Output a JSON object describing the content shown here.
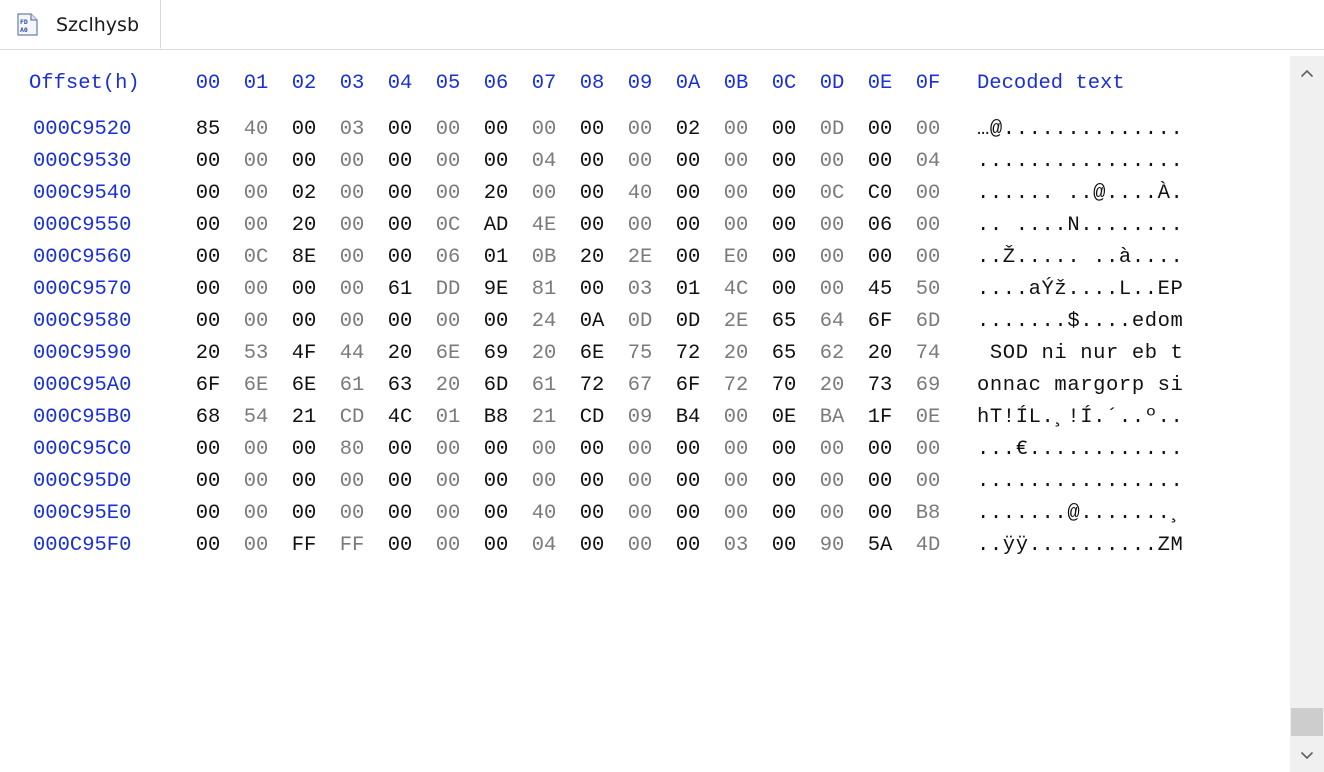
{
  "tab": {
    "label": "Szclhysb",
    "icon": "hex-file-icon"
  },
  "header": {
    "offset_label": "Offset(h)",
    "columns": [
      "00",
      "01",
      "02",
      "03",
      "04",
      "05",
      "06",
      "07",
      "08",
      "09",
      "0A",
      "0B",
      "0C",
      "0D",
      "0E",
      "0F"
    ],
    "text_label": "Decoded text"
  },
  "rows": [
    {
      "offset": "000C9520",
      "bytes": [
        "85",
        "40",
        "00",
        "03",
        "00",
        "00",
        "00",
        "00",
        "00",
        "00",
        "02",
        "00",
        "00",
        "0D",
        "00",
        "00"
      ],
      "text": "…@.............."
    },
    {
      "offset": "000C9530",
      "bytes": [
        "00",
        "00",
        "00",
        "00",
        "00",
        "00",
        "00",
        "04",
        "00",
        "00",
        "00",
        "00",
        "00",
        "00",
        "00",
        "04"
      ],
      "text": "................"
    },
    {
      "offset": "000C9540",
      "bytes": [
        "00",
        "00",
        "02",
        "00",
        "00",
        "00",
        "20",
        "00",
        "00",
        "40",
        "00",
        "00",
        "00",
        "0C",
        "C0",
        "00"
      ],
      "text": "...... ..@....À."
    },
    {
      "offset": "000C9550",
      "bytes": [
        "00",
        "00",
        "20",
        "00",
        "00",
        "0C",
        "AD",
        "4E",
        "00",
        "00",
        "00",
        "00",
        "00",
        "00",
        "06",
        "00"
      ],
      "text": ".. ....­N........"
    },
    {
      "offset": "000C9560",
      "bytes": [
        "00",
        "0C",
        "8E",
        "00",
        "00",
        "06",
        "01",
        "0B",
        "20",
        "2E",
        "00",
        "E0",
        "00",
        "00",
        "00",
        "00"
      ],
      "text": "..Ž..... ..à...."
    },
    {
      "offset": "000C9570",
      "bytes": [
        "00",
        "00",
        "00",
        "00",
        "61",
        "DD",
        "9E",
        "81",
        "00",
        "03",
        "01",
        "4C",
        "00",
        "00",
        "45",
        "50"
      ],
      "text": "....aÝž....L..EP"
    },
    {
      "offset": "000C9580",
      "bytes": [
        "00",
        "00",
        "00",
        "00",
        "00",
        "00",
        "00",
        "24",
        "0A",
        "0D",
        "0D",
        "2E",
        "65",
        "64",
        "6F",
        "6D"
      ],
      "text": ".......$....edom"
    },
    {
      "offset": "000C9590",
      "bytes": [
        "20",
        "53",
        "4F",
        "44",
        "20",
        "6E",
        "69",
        "20",
        "6E",
        "75",
        "72",
        "20",
        "65",
        "62",
        "20",
        "74"
      ],
      "text": " SOD ni nur eb t"
    },
    {
      "offset": "000C95A0",
      "bytes": [
        "6F",
        "6E",
        "6E",
        "61",
        "63",
        "20",
        "6D",
        "61",
        "72",
        "67",
        "6F",
        "72",
        "70",
        "20",
        "73",
        "69"
      ],
      "text": "onnac margorp si"
    },
    {
      "offset": "000C95B0",
      "bytes": [
        "68",
        "54",
        "21",
        "CD",
        "4C",
        "01",
        "B8",
        "21",
        "CD",
        "09",
        "B4",
        "00",
        "0E",
        "BA",
        "1F",
        "0E"
      ],
      "text": "hT!ÍL.¸!Í.´..º.."
    },
    {
      "offset": "000C95C0",
      "bytes": [
        "00",
        "00",
        "00",
        "80",
        "00",
        "00",
        "00",
        "00",
        "00",
        "00",
        "00",
        "00",
        "00",
        "00",
        "00",
        "00"
      ],
      "text": "...€............"
    },
    {
      "offset": "000C95D0",
      "bytes": [
        "00",
        "00",
        "00",
        "00",
        "00",
        "00",
        "00",
        "00",
        "00",
        "00",
        "00",
        "00",
        "00",
        "00",
        "00",
        "00"
      ],
      "text": "................"
    },
    {
      "offset": "000C95E0",
      "bytes": [
        "00",
        "00",
        "00",
        "00",
        "00",
        "00",
        "00",
        "40",
        "00",
        "00",
        "00",
        "00",
        "00",
        "00",
        "00",
        "B8"
      ],
      "text": ".......@.......¸"
    },
    {
      "offset": "000C95F0",
      "bytes": [
        "00",
        "00",
        "FF",
        "FF",
        "00",
        "00",
        "00",
        "04",
        "00",
        "00",
        "00",
        "03",
        "00",
        "90",
        "5A",
        "4D"
      ],
      "text": "..ÿÿ..........ZM"
    }
  ],
  "scrollbar": {
    "up_icon": "chevron-up-icon",
    "down_icon": "chevron-down-icon"
  },
  "colors": {
    "offset_blue": "#1a2fd6",
    "even_byte": "#111111",
    "odd_byte": "#7a7a7a",
    "scrollbar_track": "#f0f0f0",
    "scrollbar_thumb": "#cdcdcd"
  }
}
